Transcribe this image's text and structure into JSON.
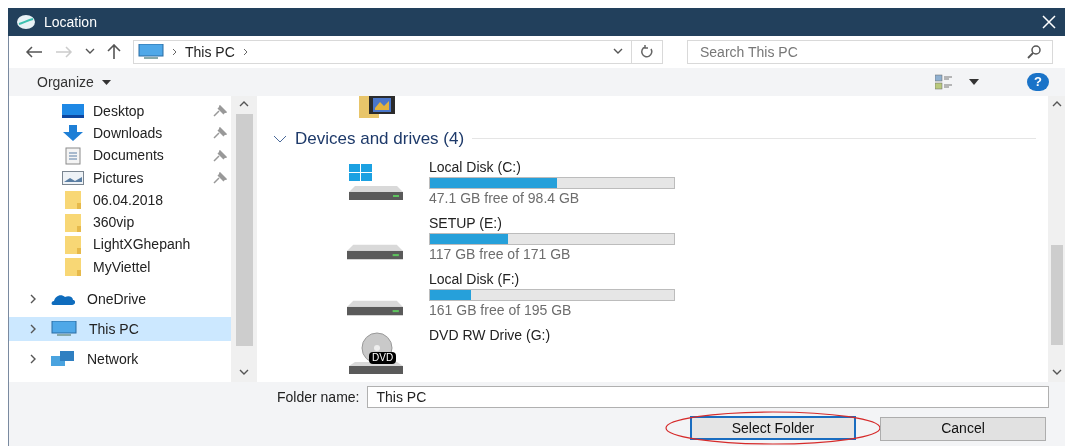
{
  "window": {
    "title": "Location"
  },
  "address_bar": {
    "crumbs": [
      "This PC"
    ]
  },
  "search": {
    "placeholder": "Search This PC"
  },
  "toolbar": {
    "organize": "Organize",
    "help": "?"
  },
  "sidebar": {
    "quick_access": [
      {
        "label": "Desktop",
        "kind": "desktop",
        "pinned": true
      },
      {
        "label": "Downloads",
        "kind": "downloads",
        "pinned": true
      },
      {
        "label": "Documents",
        "kind": "documents",
        "pinned": true
      },
      {
        "label": "Pictures",
        "kind": "pictures",
        "pinned": true
      },
      {
        "label": "06.04.2018",
        "kind": "folder",
        "pinned": false
      },
      {
        "label": "360vip",
        "kind": "folder",
        "pinned": false
      },
      {
        "label": "LightXGhepanh",
        "kind": "folder",
        "pinned": false
      },
      {
        "label": "MyViettel",
        "kind": "folder",
        "pinned": false
      }
    ],
    "locations": [
      {
        "label": "OneDrive",
        "kind": "cloud",
        "selected": false
      },
      {
        "label": "This PC",
        "kind": "pc",
        "selected": true
      },
      {
        "label": "Network",
        "kind": "network",
        "selected": false
      }
    ]
  },
  "group": {
    "title": "Devices and drives (4)",
    "expanded": true
  },
  "drives": [
    {
      "name": "Local Disk (C:)",
      "kind": "system",
      "level": 0.52,
      "space": "47.1 GB free of 98.4 GB"
    },
    {
      "name": "SETUP (E:)",
      "kind": "disk",
      "level": 0.32,
      "space": "117 GB free of 171 GB"
    },
    {
      "name": "Local Disk (F:)",
      "kind": "disk",
      "level": 0.17,
      "space": "161 GB free of 195 GB"
    },
    {
      "name": "DVD RW Drive (G:)",
      "kind": "dvd",
      "dvd_label": "DVD"
    }
  ],
  "footer": {
    "folder_label": "Folder name:",
    "folder_value": "This PC",
    "buttons": [
      {
        "label": "Select Folder",
        "highlighted": true
      },
      {
        "label": "Cancel",
        "highlighted": false
      }
    ]
  }
}
